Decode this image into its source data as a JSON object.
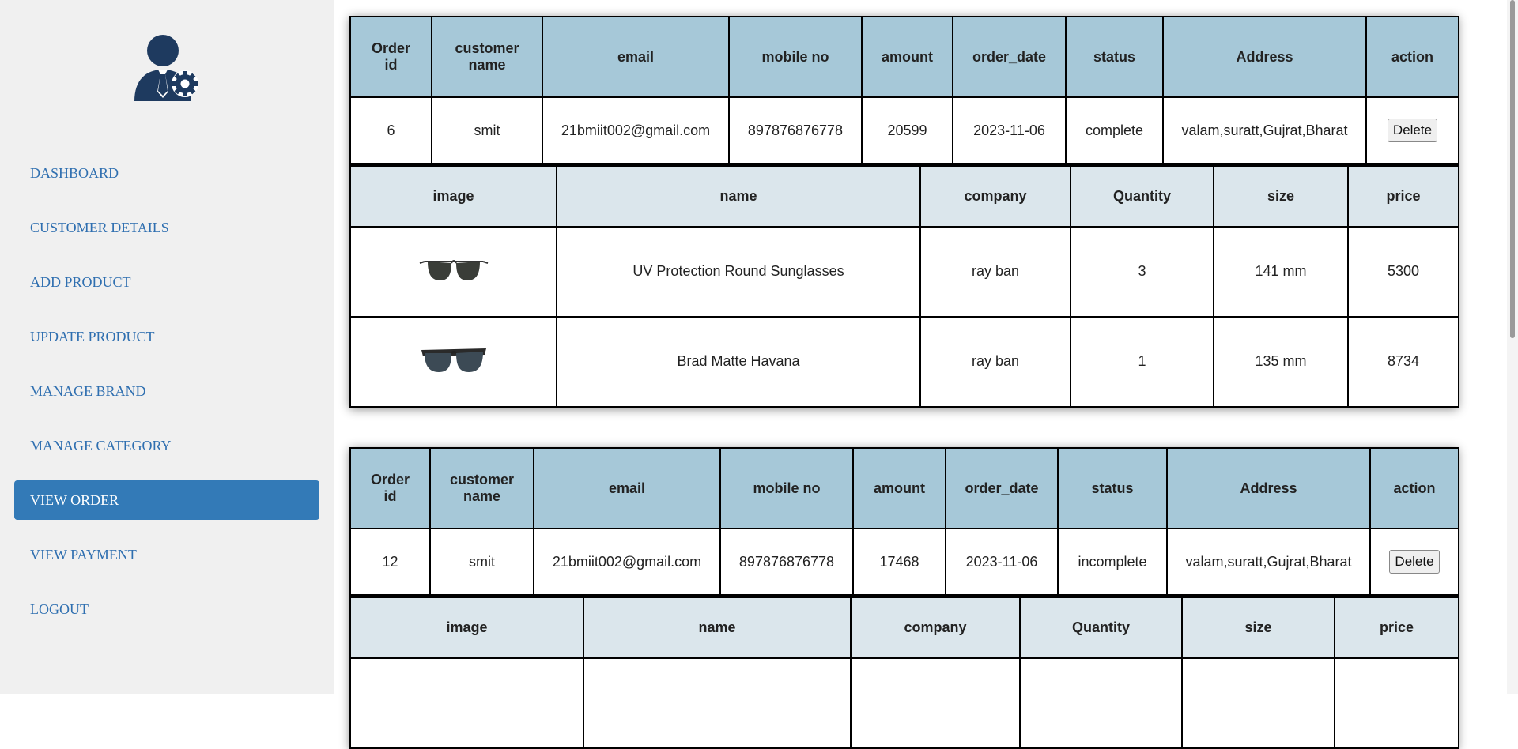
{
  "sidebar": {
    "logo_icon": "admin-user-gear-icon",
    "items": [
      {
        "label": "DASHBOARD",
        "active": false
      },
      {
        "label": "CUSTOMER DETAILS",
        "active": false
      },
      {
        "label": "ADD PRODUCT",
        "active": false
      },
      {
        "label": "UPDATE PRODUCT",
        "active": false
      },
      {
        "label": "MANAGE BRAND",
        "active": false
      },
      {
        "label": "MANAGE CATEGORY",
        "active": false
      },
      {
        "label": "VIEW ORDER",
        "active": true
      },
      {
        "label": "VIEW PAYMENT",
        "active": false
      },
      {
        "label": "LOGOUT",
        "active": false
      }
    ],
    "accent_color": "#337ab7"
  },
  "order_columns": {
    "order_id_line1": "Order",
    "order_id_line2": "id",
    "customer_line1": "customer",
    "customer_line2": "name",
    "email": "email",
    "mobile": "mobile no",
    "amount": "amount",
    "order_date": "order_date",
    "status": "status",
    "address": "Address",
    "action": "action"
  },
  "item_columns": {
    "image": "image",
    "name": "name",
    "company": "company",
    "quantity": "Quantity",
    "size": "size",
    "price": "price"
  },
  "orders": [
    {
      "order_id": "6",
      "customer_name": "smit",
      "email": "21bmiit002@gmail.com",
      "mobile": "897876876778",
      "amount": "20599",
      "order_date": "2023-11-06",
      "status": "complete",
      "address": "valam,suratt,Gujrat,Bharat",
      "action_label": "Delete",
      "items": [
        {
          "image": "sunglasses-round-icon",
          "name": "UV Protection Round Sunglasses",
          "company": "ray ban",
          "quantity": "3",
          "size": "141 mm",
          "price": "5300"
        },
        {
          "image": "sunglasses-wayfarer-icon",
          "name": "Brad Matte Havana",
          "company": "ray ban",
          "quantity": "1",
          "size": "135 mm",
          "price": "8734"
        }
      ]
    },
    {
      "order_id": "12",
      "customer_name": "smit",
      "email": "21bmiit002@gmail.com",
      "mobile": "897876876778",
      "amount": "17468",
      "order_date": "2023-11-06",
      "status": "incomplete",
      "address": "valam,suratt,Gujrat,Bharat",
      "action_label": "Delete"
    }
  ]
}
